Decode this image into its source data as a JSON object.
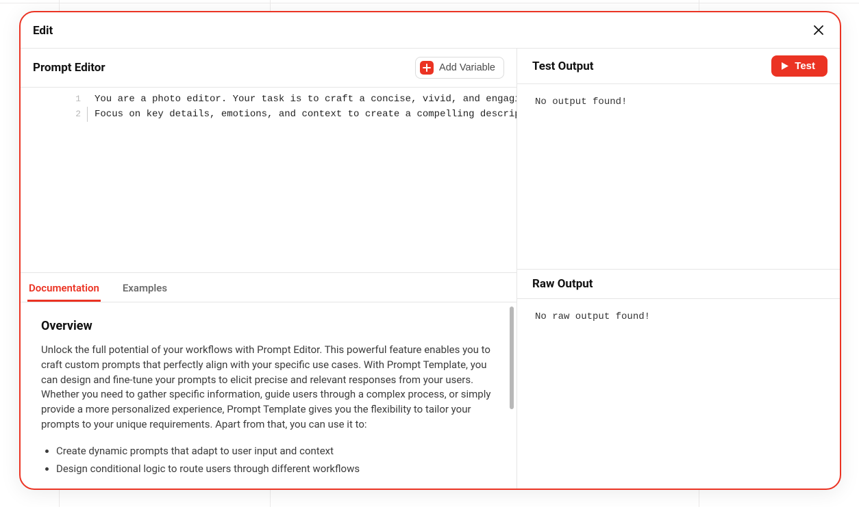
{
  "modal": {
    "title": "Edit"
  },
  "promptEditor": {
    "title": "Prompt Editor",
    "addVariableLabel": "Add Variable",
    "lines": [
      {
        "n": "1",
        "text": "You are a photo editor. Your task is to craft a concise, vivid, and engaging c"
      },
      {
        "n": "2",
        "text": "Focus on key details, emotions, and context to create a compelling descriptio"
      }
    ]
  },
  "tabs": {
    "documentation": "Documentation",
    "examples": "Examples",
    "active": "documentation"
  },
  "documentation": {
    "heading": "Overview",
    "paragraph": "Unlock the full potential of your workflows with Prompt Editor. This powerful feature enables you to craft custom prompts that perfectly align with your specific use cases. With Prompt Template, you can design and fine-tune your prompts to elicit precise and relevant responses from your users. Whether you need to gather specific information, guide users through a complex process, or simply provide a more personalized experience, Prompt Template gives you the flexibility to tailor your prompts to your unique requirements. Apart from that, you can use it to:",
    "bullets": [
      "Create dynamic prompts that adapt to user input and context",
      "Design conditional logic to route users through different workflows"
    ]
  },
  "testOutput": {
    "title": "Test Output",
    "buttonLabel": "Test",
    "empty": "No output found!"
  },
  "rawOutput": {
    "title": "Raw Output",
    "empty": "No raw output found!"
  },
  "colors": {
    "accent": "#eb3323"
  }
}
